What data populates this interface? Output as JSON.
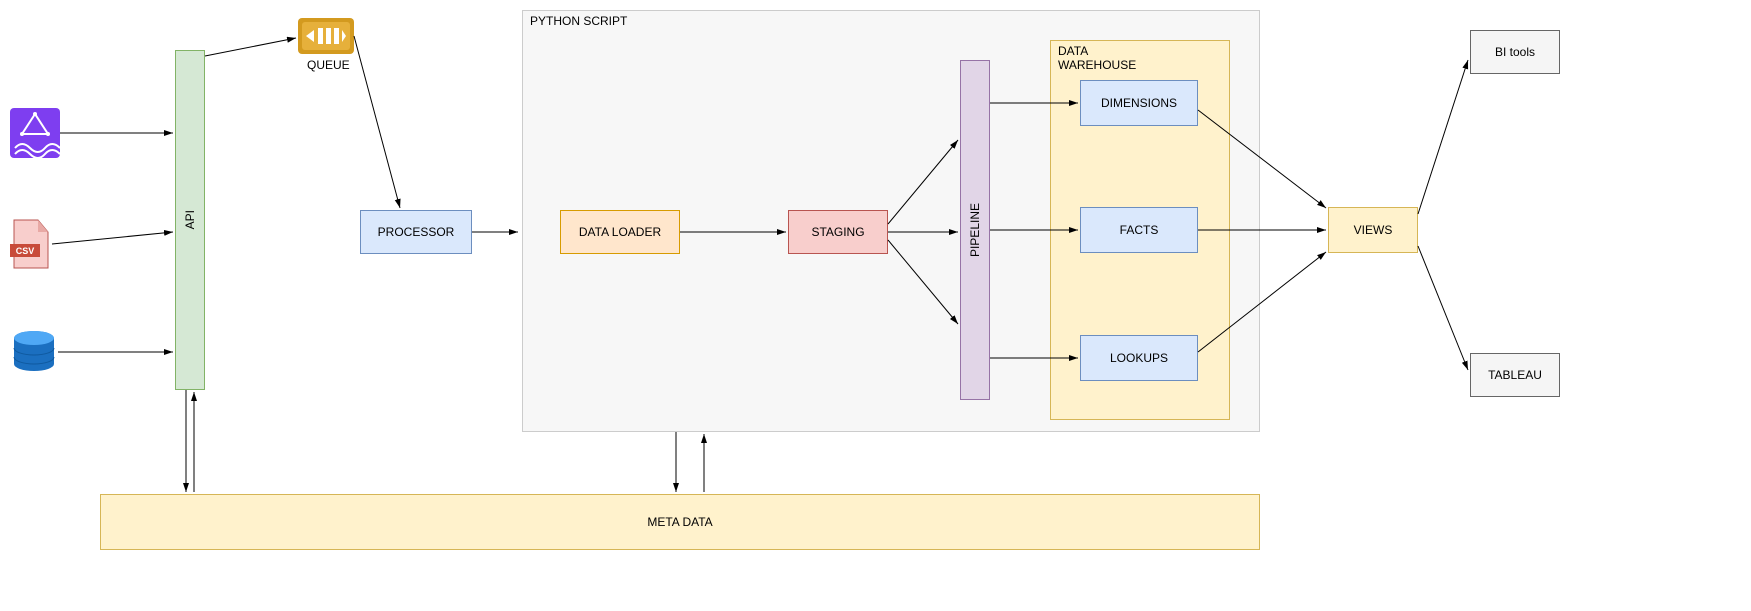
{
  "containers": {
    "python_script": {
      "label": "PYTHON SCRIPT"
    },
    "data_warehouse": {
      "label": "DATA\nWAREHOUSE"
    }
  },
  "nodes": {
    "queue": {
      "label": "QUEUE"
    },
    "api": {
      "label": "API"
    },
    "processor": {
      "label": "PROCESSOR"
    },
    "data_loader": {
      "label": "DATA LOADER"
    },
    "staging": {
      "label": "STAGING"
    },
    "pipeline": {
      "label": "PIPELINE"
    },
    "dimensions": {
      "label": "DIMENSIONS"
    },
    "facts": {
      "label": "FACTS"
    },
    "lookups": {
      "label": "LOOKUPS"
    },
    "meta_data": {
      "label": "META DATA"
    },
    "views": {
      "label": "VIEWS"
    },
    "bi_tools": {
      "label": "BI tools"
    },
    "tableau": {
      "label": "TABLEAU"
    }
  },
  "icons": {
    "kinesis": {
      "name": "aws-kinesis-icon"
    },
    "csv": {
      "name": "csv-file-icon"
    },
    "database": {
      "name": "database-icon"
    }
  },
  "palette": {
    "green": {
      "fill": "#D5E8D4",
      "stroke": "#82B366"
    },
    "blue": {
      "fill": "#DAE8FC",
      "stroke": "#6C8EBF"
    },
    "orange": {
      "fill": "#FFE6CC",
      "stroke": "#D79B00"
    },
    "red": {
      "fill": "#F8CECC",
      "stroke": "#B85450"
    },
    "purple": {
      "fill": "#E1D5E7",
      "stroke": "#9673A6"
    },
    "yellow": {
      "fill": "#FFF2CC",
      "stroke": "#D6B656"
    },
    "grey": {
      "fill": "#F5F5F5",
      "stroke": "#666666"
    },
    "light": {
      "fill": "#F7F7F7",
      "stroke": "#CCCCCC"
    }
  }
}
